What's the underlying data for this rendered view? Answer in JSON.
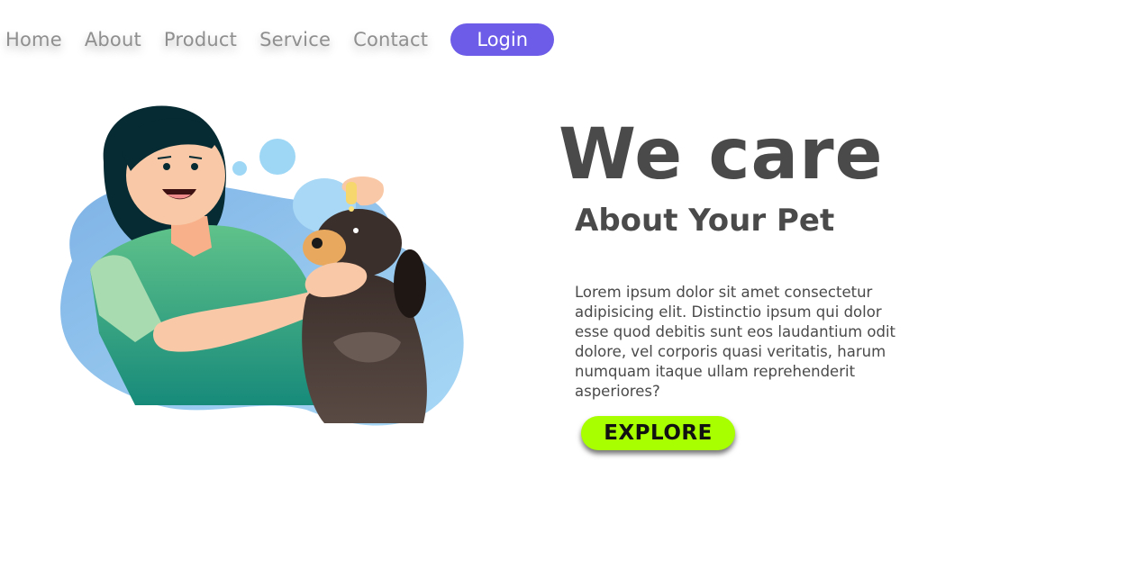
{
  "nav": {
    "links": [
      "Home",
      "About",
      "Product",
      "Service",
      "Contact"
    ],
    "login_label": "Login"
  },
  "hero": {
    "title": "We care",
    "subtitle": "About Your Pet",
    "description": "Lorem ipsum dolor sit amet consectetur adipisicing elit. Distinctio ipsum qui dolor esse quod debitis sunt eos laudantium odit dolore, vel corporis quasi veritatis, harum numquam itaque ullam reprehenderit asperiores?",
    "cta_label": "EXPLORE"
  },
  "illustration": {
    "icon": "woman-caring-dog-illustration"
  },
  "colors": {
    "nav_text": "#8f8f8f",
    "login_bg": "#6c5ce7",
    "heading": "#4a4a4a",
    "cta_bg": "#a8ff00",
    "blob": "#8ec5ea"
  }
}
